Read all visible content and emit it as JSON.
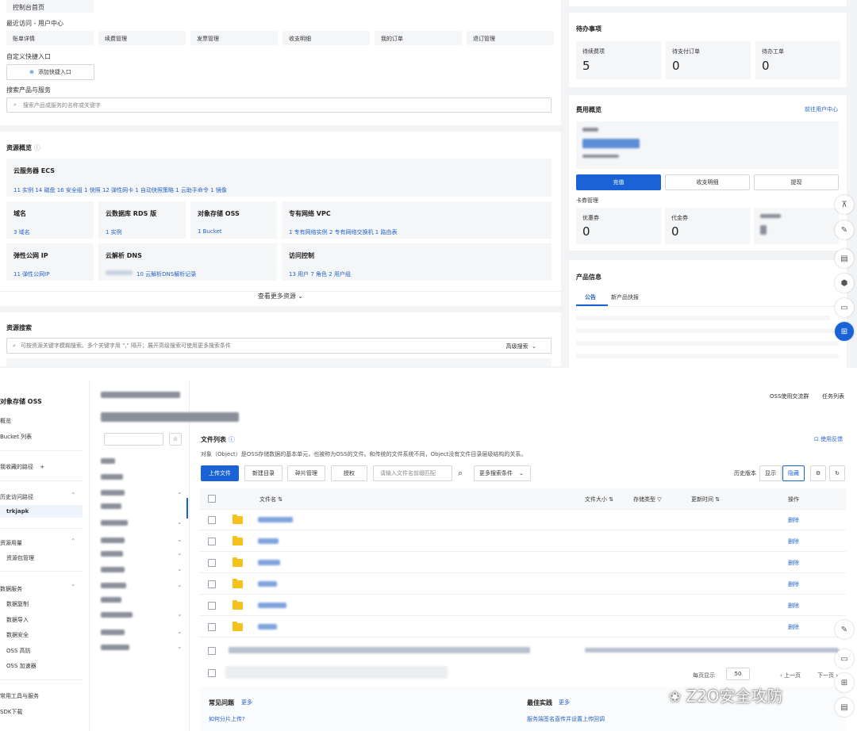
{
  "console": {
    "home_link": "控制台首页",
    "recent_label": "最近访问 - 用户中心",
    "recent_items": [
      "账单详情",
      "续费管理",
      "发票管理",
      "收支明细",
      "我的订单",
      "退订管理"
    ],
    "custom_entry_label": "自定义快捷入口",
    "add_entry_button": "添加快捷入口",
    "search_label": "搜索产品与服务",
    "search_placeholder": "搜索产品或服务的名称或关键字",
    "resources_title": "资源概览",
    "ecs": {
      "title": "云服务器 ECS",
      "stats": "11 实例 14 磁盘 16 安全组 1 快照 12 弹性网卡 1 自动快照策略 1 云助手命令 1 镜像"
    },
    "tiles_row1": [
      {
        "title": "域名",
        "stat": "3 域名"
      },
      {
        "title": "云数据库 RDS 版",
        "stat": "1 实例"
      },
      {
        "title": "对象存储 OSS",
        "stat": "1 Bucket"
      },
      {
        "title": "专有网络 VPC",
        "stat": "1 专有网络实例 2 专有网络交换机 1 路由表"
      }
    ],
    "tiles_row2": [
      {
        "title": "弹性公网 IP",
        "stat": "11 弹性公网IP"
      },
      {
        "title": "云解析 DNS",
        "stat": "10 云解析DNS解析记录"
      },
      {
        "title": "访问控制",
        "stat": "13 用户 7 角色 2 用户组"
      }
    ],
    "more_resources": "查看更多资源",
    "resource_search_title": "资源搜索",
    "resource_search_placeholder": "可按资源关键字模糊搜索。多个关键字用 \",\" 隔开；展开高级搜索可使用更多搜索条件",
    "advanced_search": "高级搜索",
    "todo": {
      "title": "待办事项",
      "items": [
        {
          "label": "待续费项",
          "value": "5"
        },
        {
          "label": "待支付订单",
          "value": "0"
        },
        {
          "label": "待办工单",
          "value": "0"
        }
      ]
    },
    "fees": {
      "title": "费用概览",
      "link": "前往用户中心",
      "recharge": "充值",
      "details": "收支明细",
      "withdraw": "提现",
      "card_label": "卡券管理",
      "cards": [
        {
          "label": "优惠券",
          "value": "0"
        },
        {
          "label": "代金券",
          "value": "0"
        }
      ]
    },
    "product": {
      "title": "产品信息",
      "tabs": [
        "公告",
        "新产品快报"
      ]
    }
  },
  "oss": {
    "sidebar_title": "对象存储 OSS",
    "nav": {
      "overview": "概览",
      "buckets": "Bucket 列表",
      "favorites": "我收藏的路径",
      "history": "历史访问路径",
      "history_item": "trkjapk",
      "resource_group": "资源用量",
      "resource_pack": "资源包管理",
      "data_service": "数据服务",
      "data_items": [
        "数据复制",
        "数据导入",
        "数据安全",
        "OSS 高防",
        "OSS 加速器"
      ],
      "tools": "常用工具与服务",
      "sdk": "SDK下载"
    },
    "top_links": [
      "OSS使用交流群",
      "任务列表"
    ],
    "file_list_title": "文件列表",
    "feedback": "使用反馈",
    "description": "对象（Object）是OSS存储数据的基本单元，也被称为OSS的文件。和传统的文件系统不同，Object没有文件目录层级结构的关系。",
    "toolbar": {
      "upload": "上传文件",
      "new_dir": "新建目录",
      "fragments": "碎片管理",
      "auth": "授权",
      "search_placeholder": "请输入文件名前缀匹配",
      "more_search": "更多搜索条件",
      "history_version": "历史版本",
      "show": "显示",
      "hide": "隐藏"
    },
    "table_headers": {
      "name": "文件名",
      "size": "文件大小",
      "storage": "存储类型",
      "updated": "更新时间",
      "action": "操作"
    },
    "rows_action": "删除",
    "row_count": 7,
    "pagination": {
      "per_page": "每页显示",
      "per_page_value": "50",
      "prev": "上一页",
      "next": "下一页"
    },
    "faq": {
      "title": "常见问题",
      "more": "更多",
      "item": "如何分片上传?"
    },
    "best": {
      "title": "最佳实践",
      "more": "更多",
      "item": "服务端签名直传并设置上传回调"
    }
  },
  "watermark": "Z2O安全攻防",
  "colors": {
    "accent": "#1a63d6",
    "folder": "#f5c11c",
    "link": "#2563c9"
  }
}
